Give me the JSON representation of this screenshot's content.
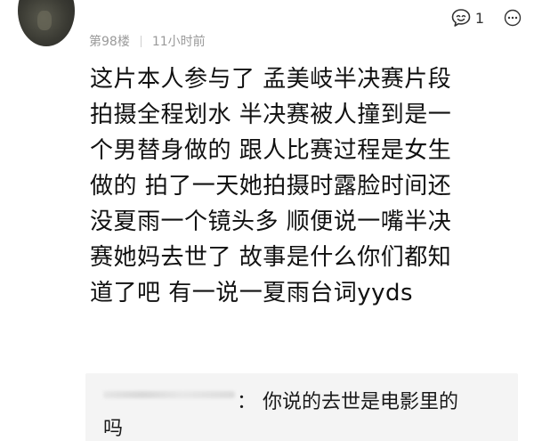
{
  "comment": {
    "floor": "第98楼",
    "time": "11小时前",
    "reply_count": "1",
    "lines": [
      "这片本人参与了 孟美岐半决赛片段",
      "拍摄全程划水 半决赛被人撞到是一",
      "个男替身做的 跟人比赛过程是女生",
      "做的 拍了一天她拍摄时露脸时间还",
      "没夏雨一个镜头多 顺便说一嘴半决",
      "赛她妈去世了 故事是什么你们都知",
      "道了吧 有一说一夏雨台词yyds"
    ]
  },
  "reply": {
    "separator": "：",
    "text_line1": "你说的去世是电影里的",
    "text_line2": "吗"
  },
  "icons": {
    "avatar": "avatar",
    "reply": "reply-bubble-icon",
    "more": "ellipsis-circle-icon"
  }
}
